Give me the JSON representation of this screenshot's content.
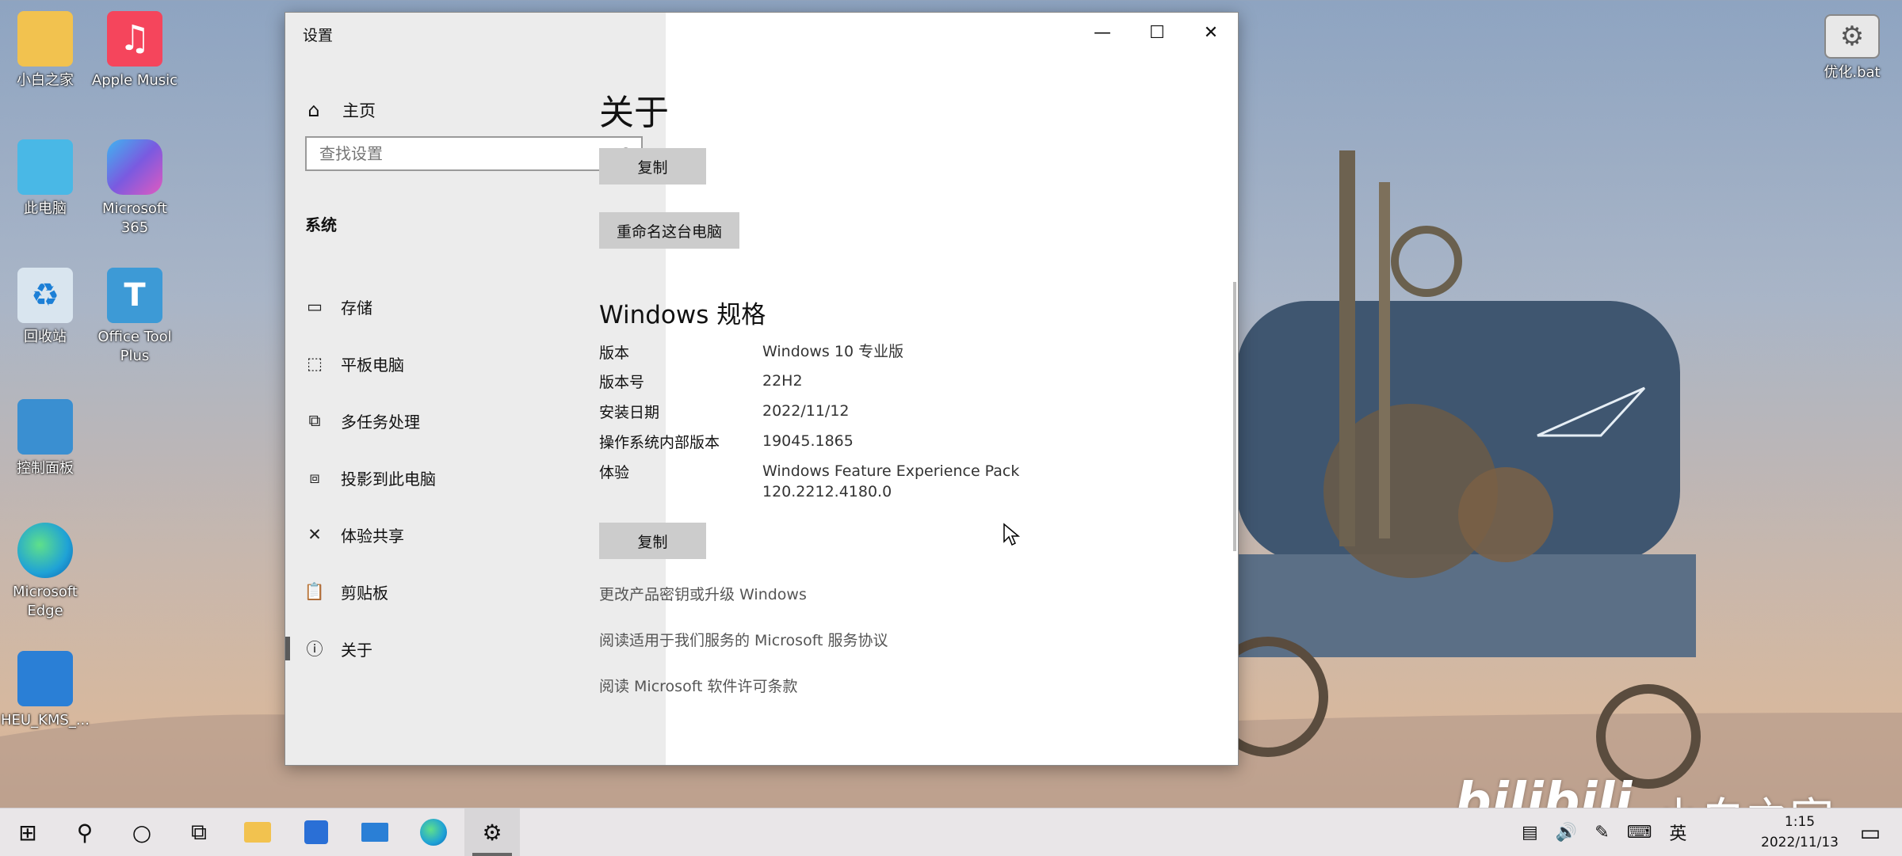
{
  "desktop": {
    "icons": [
      {
        "label": "小白之家",
        "color": "#f2c24f"
      },
      {
        "label": "Apple Music",
        "color": "#f5455c"
      },
      {
        "label": "此电脑",
        "color": "#49b8e6"
      },
      {
        "label": "Microsoft 365",
        "color": "#7a5ae0"
      },
      {
        "label": "回收站",
        "color": "#d9e5ef"
      },
      {
        "label": "Office Tool Plus",
        "color": "#3d9ad6"
      },
      {
        "label": "控制面板",
        "color": "#3a8fd1"
      },
      {
        "label": "Microsoft Edge",
        "color": "#1fa2d6"
      },
      {
        "label": "HEU_KMS_...",
        "color": "#2a7fd6"
      },
      {
        "label": "优化.bat",
        "color": "#e8e8e8"
      }
    ]
  },
  "window": {
    "title": "设置",
    "minimize": "—",
    "maximize": "☐",
    "close": "✕"
  },
  "sidebar": {
    "home_label": "主页",
    "search_placeholder": "查找设置",
    "section": "系统",
    "items": [
      {
        "label": "存储",
        "icon": "storage-icon",
        "glyph": "▭"
      },
      {
        "label": "平板电脑",
        "icon": "tablet-icon",
        "glyph": "⬚"
      },
      {
        "label": "多任务处理",
        "icon": "multitask-icon",
        "glyph": "⧉"
      },
      {
        "label": "投影到此电脑",
        "icon": "project-icon",
        "glyph": "⧈"
      },
      {
        "label": "体验共享",
        "icon": "share-icon",
        "glyph": "✕"
      },
      {
        "label": "剪贴板",
        "icon": "clipboard-icon",
        "glyph": "📋"
      },
      {
        "label": "关于",
        "icon": "info-icon",
        "glyph": "ⓘ"
      }
    ]
  },
  "main": {
    "title": "关于",
    "copy_button_1": "复制",
    "rename_button": "重命名这台电脑",
    "spec_title": "Windows 规格",
    "specs": [
      {
        "key": "版本",
        "value": "Windows 10 专业版"
      },
      {
        "key": "版本号",
        "value": "22H2"
      },
      {
        "key": "安装日期",
        "value": "2022/11/12"
      },
      {
        "key": "操作系统内部版本",
        "value": "19045.1865"
      },
      {
        "key": "体验",
        "value": "Windows Feature Experience Pack 120.2212.4180.0"
      }
    ],
    "copy_button_2": "复制",
    "links": [
      "更改产品密钥或升级 Windows",
      "阅读适用于我们服务的 Microsoft 服务协议",
      "阅读 Microsoft 软件许可条款"
    ]
  },
  "taskbar": {
    "items": [
      "start-icon",
      "search-icon",
      "cortana-icon",
      "task-view-icon",
      "file-explorer-icon",
      "store-icon",
      "mail-icon",
      "edge-icon",
      "settings-icon"
    ],
    "ime": "英",
    "time": "1:15",
    "date": "2022/11/13"
  },
  "watermark": {
    "logo": "bilibili",
    "text": "小白之家-"
  }
}
